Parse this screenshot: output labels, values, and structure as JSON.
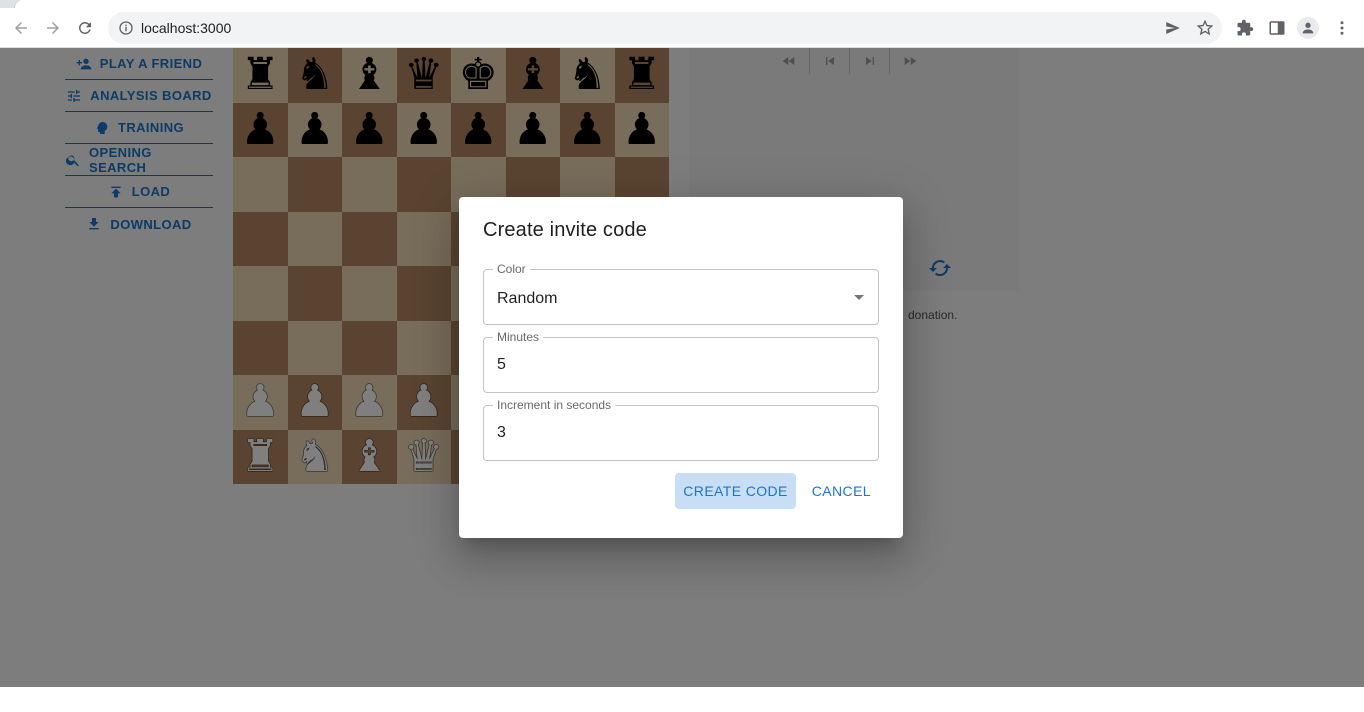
{
  "browser": {
    "url": "localhost:3000"
  },
  "sidebar": {
    "items": [
      {
        "label": "PLAY A FRIEND"
      },
      {
        "label": "ANALYSIS BOARD"
      },
      {
        "label": "TRAINING"
      },
      {
        "label": "OPENING SEARCH"
      },
      {
        "label": "LOAD"
      },
      {
        "label": "DOWNLOAD"
      }
    ]
  },
  "board": {
    "rows": [
      [
        "♜",
        "♞",
        "♝",
        "♛",
        "♚",
        "♝",
        "♞",
        "♜"
      ],
      [
        "♟",
        "♟",
        "♟",
        "♟",
        "♟",
        "♟",
        "♟",
        "♟"
      ],
      [
        "",
        "",
        "",
        "",
        "",
        "",
        "",
        ""
      ],
      [
        "",
        "",
        "",
        "",
        "",
        "",
        "",
        ""
      ],
      [
        "",
        "",
        "",
        "",
        "",
        "",
        "",
        ""
      ],
      [
        "",
        "",
        "",
        "",
        "",
        "",
        "",
        ""
      ],
      [
        "♟",
        "♟",
        "♟",
        "♟",
        "♟",
        "♟",
        "♟",
        "♟"
      ],
      [
        "♜",
        "♞",
        "♝",
        "♛",
        "♚",
        "♝",
        "♞",
        "♜"
      ]
    ],
    "colors": {
      "light": "#f0d9b5",
      "dark": "#b58863"
    }
  },
  "side_panel": {
    "donation_text": "donation."
  },
  "dialog": {
    "title": "Create invite code",
    "color_label": "Color",
    "color_value": "Random",
    "minutes_label": "Minutes",
    "minutes_value": "5",
    "increment_label": "Increment in seconds",
    "increment_value": "3",
    "create_label": "CREATE CODE",
    "cancel_label": "CANCEL"
  },
  "theme": {
    "accent": "#1976d2"
  }
}
